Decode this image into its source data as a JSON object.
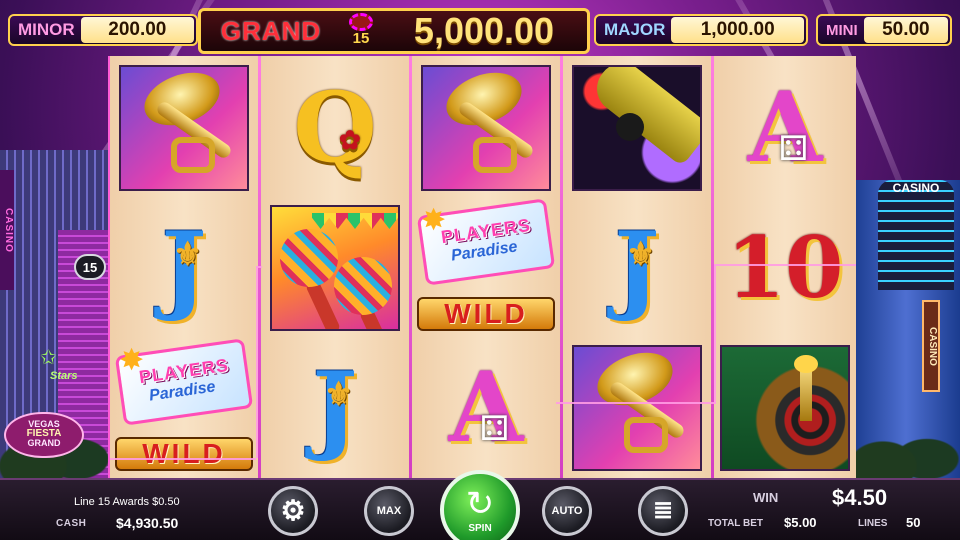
{
  "jackpots": {
    "minor": {
      "label": "MINOR",
      "amount": "200.00"
    },
    "grand": {
      "label": "GRAND",
      "amount": "5,000.00",
      "badge_number": "15"
    },
    "major": {
      "label": "MAJOR",
      "amount": "1,000.00"
    },
    "mini": {
      "label": "MINI",
      "amount": "50.00"
    }
  },
  "reels": [
    [
      "trumpet",
      "J",
      "wild"
    ],
    [
      "Q",
      "maracas",
      "J"
    ],
    [
      "trumpet",
      "wild",
      "A"
    ],
    [
      "champagne",
      "J",
      "trumpet"
    ],
    [
      "A",
      "10",
      "roulette"
    ]
  ],
  "symbols": {
    "j_text": "J",
    "q_text": "Q",
    "a_text": "A",
    "ten_text": "10",
    "wild_players": "PLAYERS",
    "wild_paradise": "Paradise",
    "wild_text": "WILD"
  },
  "payline_marker": "15",
  "background": {
    "casino_left": "CASINO",
    "casino_right_top": "CASINO",
    "casino_right_side": "CASINO",
    "vegas_sign": {
      "line1": "VEGAS",
      "line2": "FIESTA",
      "line3": "GRAND"
    },
    "stars_sign": "Stars"
  },
  "status": {
    "award_text": "Line 15 Awards $0.50",
    "cash_label": "CASH",
    "cash_value": "$4,930.50",
    "win_label": "WIN",
    "win_value": "$4.50",
    "total_bet_label": "TOTAL BET",
    "total_bet_value": "$5.00",
    "lines_label": "LINES",
    "lines_value": "50"
  },
  "controls": {
    "settings_icon": "gear-icon",
    "max_label": "MAX",
    "spin_label": "SPIN",
    "auto_label": "AUTO",
    "coins_icon": "coin-stack-icon"
  },
  "colors": {
    "payline": "#ff9be3",
    "spin_button": "#1f9a2a",
    "jackpot_border": "#ffd14d",
    "grand_label": "#ff2f3a"
  }
}
